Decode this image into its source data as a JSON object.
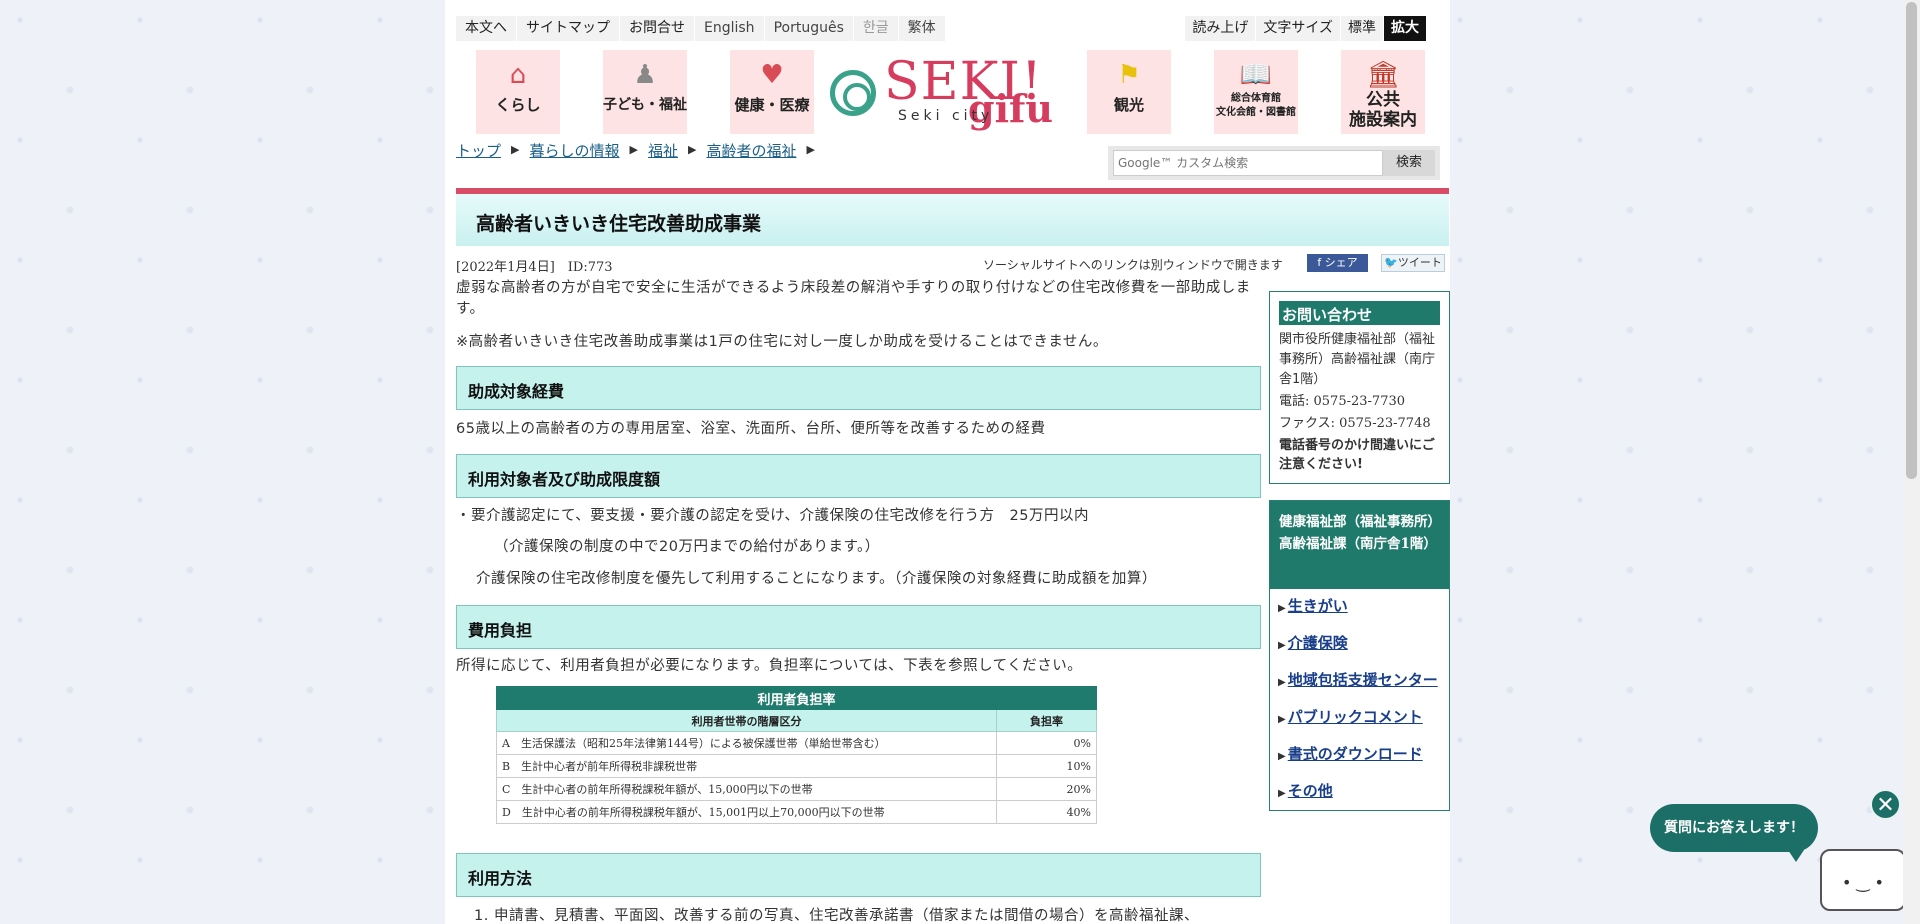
{
  "util_nav": {
    "left": [
      "本文へ",
      "サイトマップ",
      "お問合せ"
    ],
    "langs": [
      "English",
      "Português",
      "한글",
      "繁体"
    ],
    "right": [
      "読み上げ",
      "文字サイズ",
      "標準",
      "拡大"
    ]
  },
  "tiles": {
    "kurashi": "くらし",
    "kodomo": "子ども・福祉",
    "kenko": "健康・医療",
    "kanko": "観光",
    "taiikukan_1": "総合体育館",
    "taiikukan_2": "文化会館・図書館",
    "kokyo_1": "公共",
    "kokyo_2": "施設案内"
  },
  "logo": {
    "seki": "SEKI!",
    "gifu": "gifu",
    "city": "Seki city"
  },
  "breadcrumb": [
    "トップ",
    "暮らしの情報",
    "福祉",
    "高齢者の福祉"
  ],
  "search": {
    "placeholder": "Google™ カスタム検索",
    "button": "検索"
  },
  "page_title": "高齢者いきいき住宅改善助成事業",
  "meta": "[2022年1月4日]　ID:773",
  "social": {
    "note": "ソーシャルサイトへのリンクは別ウィンドウで開きます",
    "share": "f シェア",
    "tweet": "ツイート"
  },
  "intro": "虚弱な高齢者の方が自宅で安全に生活ができるよう床段差の解消や手すりの取り付けなどの住宅改修費を一部助成します。",
  "note": "※高齢者いきいき住宅改善助成事業は1戸の住宅に対し一度しか助成を受けることはできません。",
  "sections": {
    "s1_title": "助成対象経費",
    "s1_body": "65歳以上の高齢者の方の専用居室、浴室、洗面所、台所、便所等を改善するための経費",
    "s2_title": "利用対象者及び助成限度額",
    "s2_line1": "・要介護認定にて、要支援・要介護の認定を受け、介護保険の住宅改修を行う方　25万円以内",
    "s2_line2": "（介護保険の制度の中で20万円までの給付があります。）",
    "s2_line3": "介護保険の住宅改修制度を優先して利用することになります。（介護保険の対象経費に助成額を加算）",
    "s3_title": "費用負担",
    "s3_body": "所得に応じて、利用者負担が必要になります。負担率については、下表を参照してください。",
    "s4_title": "利用方法",
    "s4_item1": "1. 申請書、見積書、平面図、改善する前の写真、住宅改善承諾書（借家または間借の場合）を高齢福祉課、"
  },
  "burden_table": {
    "caption": "利用者負担率",
    "col1": "利用者世帯の階層区分",
    "col2": "負担率",
    "rows": [
      {
        "label": "A　生活保護法（昭和25年法律第144号）による被保護世帯（単給世帯含む）",
        "rate": "0%"
      },
      {
        "label": "B　生計中心者が前年所得税非課税世帯",
        "rate": "10%"
      },
      {
        "label": "C　生計中心者の前年所得税課税年額が、15,000円以下の世帯",
        "rate": "20%"
      },
      {
        "label": "D　生計中心者の前年所得税課税年額が、15,001円以上70,000円以下の世帯",
        "rate": "40%"
      }
    ]
  },
  "contact": {
    "heading": "お問い合わせ",
    "dept": "関市役所健康福祉部（福祉事務所）高齢福祉課（南庁舎1階）",
    "tel": "電話: 0575-23-7730",
    "fax": "ファクス: 0575-23-7748",
    "warn": "電話番号のかけ間違いにご注意ください!"
  },
  "related": {
    "heading": "健康福祉部（福祉事務所）高齢福祉課（南庁舎1階）",
    "links": [
      "生きがい",
      "介護保険",
      "地域包括支援センター",
      "パブリックコメント",
      "書式のダウンロード",
      "その他"
    ]
  },
  "chat": {
    "bubble": "質問にお答えします！",
    "close": "✕"
  }
}
